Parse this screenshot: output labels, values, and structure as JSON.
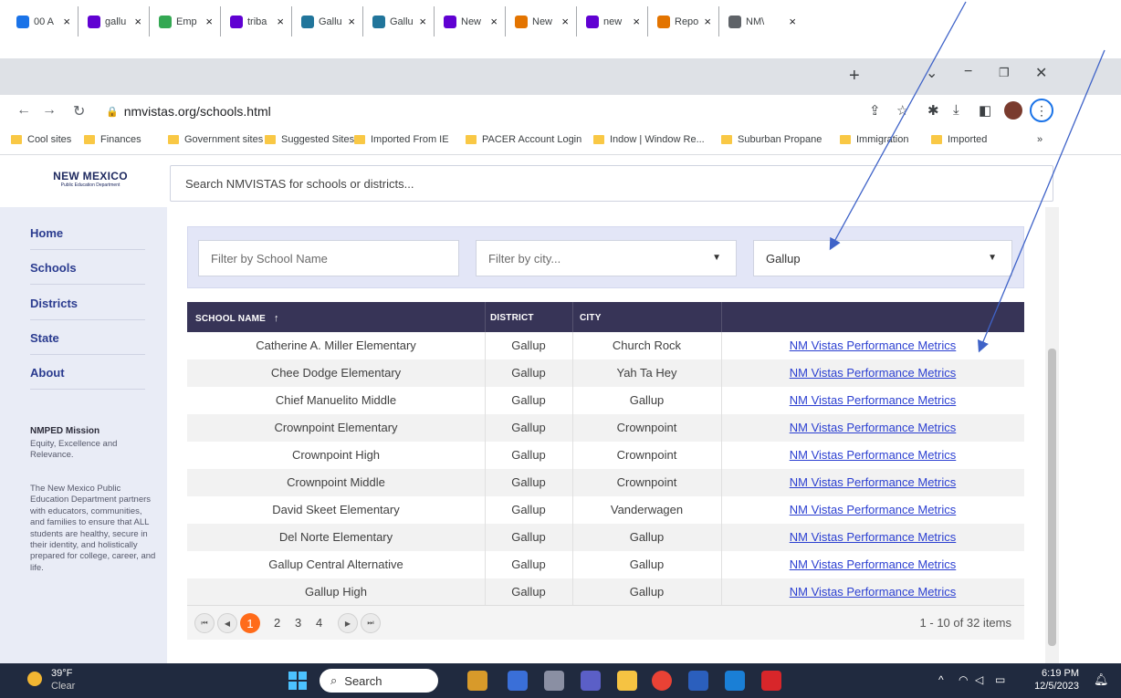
{
  "browser": {
    "tabs": [
      {
        "label": "00 A",
        "color": "#1a73e8"
      },
      {
        "label": "gallu",
        "color": "#6001d2"
      },
      {
        "label": "Emp",
        "color": "#34a853"
      },
      {
        "label": "triba",
        "color": "#6001d2"
      },
      {
        "label": "Gallu",
        "color": "#21759b"
      },
      {
        "label": "Gallu",
        "color": "#21759b"
      },
      {
        "label": "New",
        "color": "#6001d2"
      },
      {
        "label": "New",
        "color": "#e37400"
      },
      {
        "label": "new",
        "color": "#6001d2"
      },
      {
        "label": "Repo",
        "color": "#e37400"
      },
      {
        "label": "NM\\",
        "color": "#5f6368"
      }
    ],
    "url": "nmvistas.org/schools.html",
    "bookmarks": [
      "Cool sites",
      "Finances",
      "Government sites",
      "Suggested Sites",
      "Imported From IE",
      "PACER Account Login",
      "Indow | Window Re...",
      "Suburban Propane",
      "Immigration",
      "Imported"
    ]
  },
  "site": {
    "logo_line1": "NEW MEXICO",
    "logo_line2": "Public Education Department",
    "search_placeholder": "Search NMVISTAS for schools or districts...",
    "nav": [
      "Home",
      "Schools",
      "Districts",
      "State",
      "About"
    ],
    "mission_title": "NMPED Mission",
    "mission_lead": "Equity, Excellence and Relevance.",
    "mission_body": "The New Mexico Public Education Department partners with educators, communities, and families to ensure that ALL students are healthy, secure in their identity, and holistically prepared for college, career, and life."
  },
  "filters": {
    "school_placeholder": "Filter by School Name",
    "city_placeholder": "Filter by city...",
    "district_value": "Gallup"
  },
  "table": {
    "headers": [
      "SCHOOL NAME",
      "DISTRICT",
      "CITY",
      ""
    ],
    "rows": [
      [
        "Catherine A. Miller Elementary",
        "Gallup",
        "Church Rock",
        "NM Vistas Performance Metrics"
      ],
      [
        "Chee Dodge Elementary",
        "Gallup",
        "Yah Ta Hey",
        "NM Vistas Performance Metrics"
      ],
      [
        "Chief Manuelito Middle",
        "Gallup",
        "Gallup",
        "NM Vistas Performance Metrics"
      ],
      [
        "Crownpoint Elementary",
        "Gallup",
        "Crownpoint",
        "NM Vistas Performance Metrics"
      ],
      [
        "Crownpoint High",
        "Gallup",
        "Crownpoint",
        "NM Vistas Performance Metrics"
      ],
      [
        "Crownpoint Middle",
        "Gallup",
        "Crownpoint",
        "NM Vistas Performance Metrics"
      ],
      [
        "David Skeet Elementary",
        "Gallup",
        "Vanderwagen",
        "NM Vistas Performance Metrics"
      ],
      [
        "Del Norte Elementary",
        "Gallup",
        "Gallup",
        "NM Vistas Performance Metrics"
      ],
      [
        "Gallup Central Alternative",
        "Gallup",
        "Gallup",
        "NM Vistas Performance Metrics"
      ],
      [
        "Gallup High",
        "Gallup",
        "Gallup",
        "NM Vistas Performance Metrics"
      ]
    ]
  },
  "pager": {
    "pages": [
      "1",
      "2",
      "3",
      "4"
    ],
    "current": "1",
    "info": "1 - 10 of 32 items"
  },
  "taskbar": {
    "temp": "39°F",
    "weather": "Clear",
    "search": "Search",
    "time": "6:19 PM",
    "date": "12/5/2023"
  }
}
